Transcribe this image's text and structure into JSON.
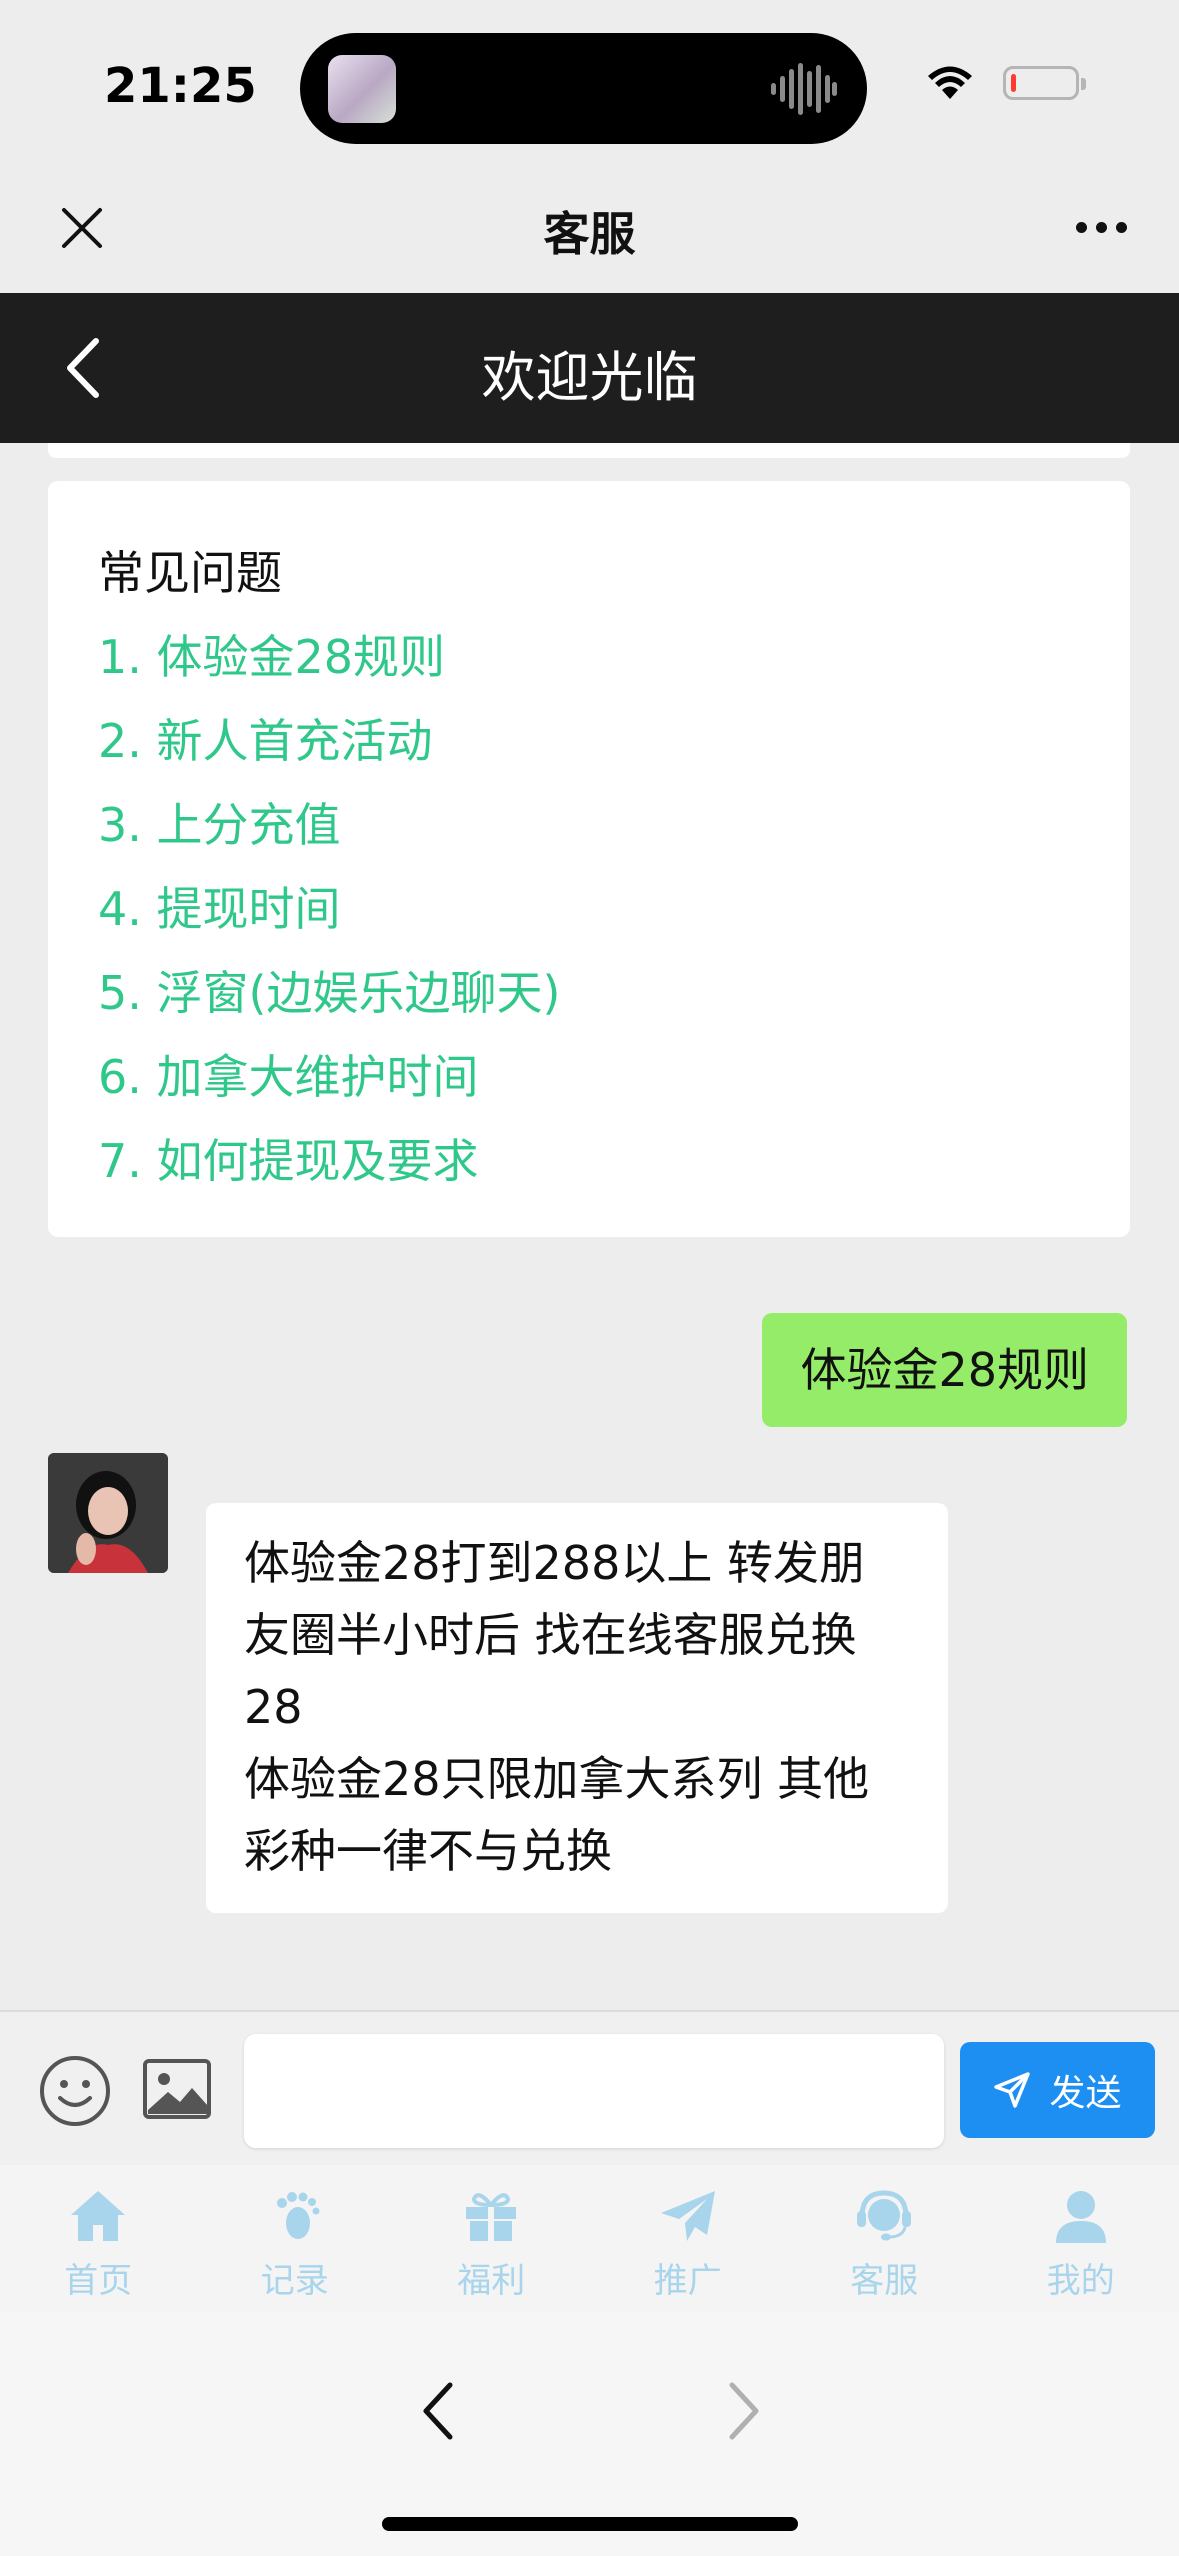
{
  "status_bar": {
    "time": "21:25",
    "battery_level": 0.08
  },
  "wechat_bar": {
    "title": "客服"
  },
  "header": {
    "title": "欢迎光临"
  },
  "faq": {
    "title": "常见问题",
    "items": [
      "1. 体验金28规则",
      "2. 新人首充活动",
      "3. 上分充值",
      "4. 提现时间",
      "5. 浮窗(边娱乐边聊天)",
      "6. 加拿大维护时间",
      "7. 如何提现及要求"
    ]
  },
  "messages": {
    "user": "体验金28规则",
    "bot_lines": [
      "体验金28打到288以上 转发朋",
      "友圈半小时后 找在线客服兑换",
      "28",
      "体验金28只限加拿大系列 其他",
      "彩种一律不与兑换"
    ]
  },
  "composer": {
    "value": "",
    "placeholder": "",
    "send_label": "发送"
  },
  "tabs": [
    {
      "label": "首页",
      "icon": "home-icon"
    },
    {
      "label": "记录",
      "icon": "footprint-icon"
    },
    {
      "label": "福利",
      "icon": "gift-icon"
    },
    {
      "label": "推广",
      "icon": "paper-plane-icon"
    },
    {
      "label": "客服",
      "icon": "headset-icon"
    },
    {
      "label": "我的",
      "icon": "user-icon"
    }
  ],
  "colors": {
    "faq_link": "#2fc88a",
    "user_bubble": "#95ec69",
    "send_button": "#1d8ff2",
    "tab_inactive": "#a8d4ec",
    "header_bg": "#1e1e1e"
  }
}
